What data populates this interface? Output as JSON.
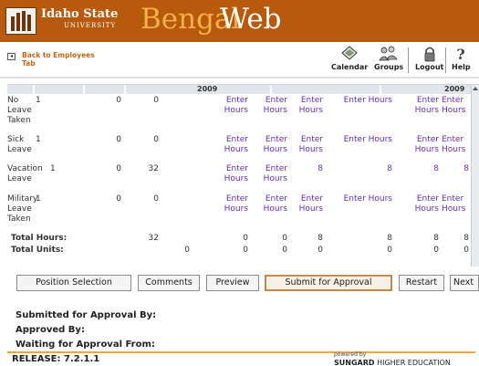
{
  "header": {
    "university_line1": "Idaho State",
    "university_line2": "UNIVERSITY",
    "app_name_1": "Bengal",
    "app_name_2": "Web",
    "brand_color": "#b85a0d",
    "accent_color": "#f7b049"
  },
  "toolbar": {
    "back_label": "Back to Employees Tab",
    "calendar_label": "Calendar",
    "groups_label": "Groups",
    "logout_label": "Logout",
    "help_label": "Help"
  },
  "timesheet": {
    "year_left": "2009",
    "year_right": "2009",
    "enter_hours": "Enter Hours",
    "rows": [
      {
        "type": "No Leave Taken",
        "col1": "1",
        "col2": "0",
        "col3": "0",
        "days": [
          "Enter Hours",
          "Enter Hours",
          "Enter Hours",
          "Enter Hours",
          "Enter Hours",
          "Enter Hours"
        ]
      },
      {
        "type": "Sick Leave",
        "col1": "1",
        "col2": "0",
        "col3": "0",
        "days": [
          "Enter Hours",
          "Enter Hours",
          "Enter Hours",
          "Enter Hours",
          "Enter Hours",
          "Enter Hours"
        ]
      },
      {
        "type": "Vacation Leave",
        "col1": "1",
        "col2": "0",
        "col3": "32",
        "days": [
          "Enter Hours",
          "Enter Hours",
          "8",
          "8",
          "8",
          "8"
        ]
      },
      {
        "type": "Military Leave Taken",
        "col1": "1",
        "col2": "0",
        "col3": "0",
        "days": [
          "Enter Hours",
          "Enter Hours",
          "Enter Hours",
          "Enter Hours",
          "Enter Hours",
          "Enter Hours"
        ]
      }
    ],
    "total_hours_label": "Total Hours:",
    "total_hours_value": "32",
    "total_hours_days": [
      "0",
      "0",
      "8",
      "8",
      "8",
      "8"
    ],
    "total_units_label": "Total Units:",
    "total_units_value": "0",
    "total_units_days": [
      "0",
      "0",
      "0",
      "0",
      "0",
      "0"
    ]
  },
  "buttons": {
    "position_selection": "Position Selection",
    "comments": "Comments",
    "preview": "Preview",
    "submit": "Submit for Approval",
    "restart": "Restart",
    "next": "Next"
  },
  "approval": {
    "submitted_label": "Submitted for Approval By:",
    "approved_label": "Approved By:",
    "waiting_label": "Waiting for Approval From:"
  },
  "footer": {
    "release": "RELEASE: 7.2.1.1",
    "powered_by": "powered by",
    "sungard": "SUNGARD",
    "higher_ed": "HIGHER EDUCATION"
  }
}
